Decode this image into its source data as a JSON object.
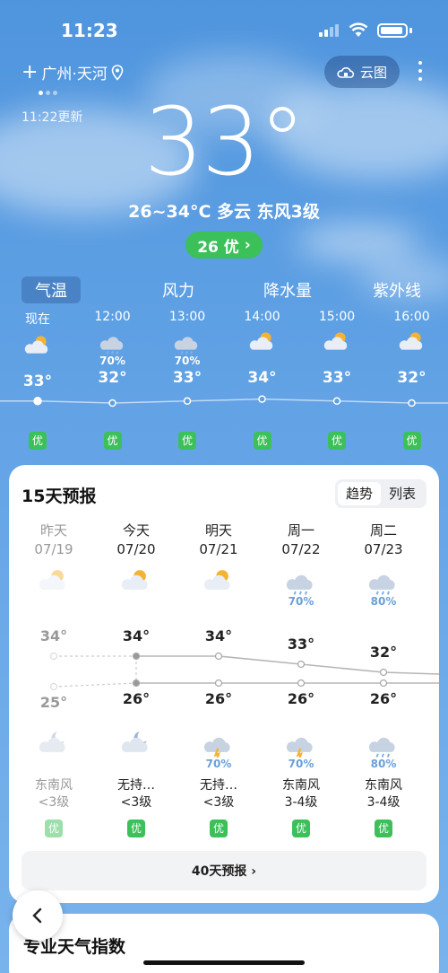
{
  "status": {
    "time": "11:23"
  },
  "location": {
    "city": "广州·天河",
    "updated": "11:22更新"
  },
  "header": {
    "cloud_map_label": "云图"
  },
  "current": {
    "temp": "33°",
    "summary": "26~34°C 多云 东风3级",
    "aqi": "26 优"
  },
  "tabs": [
    {
      "label": "气温"
    },
    {
      "label": "风力"
    },
    {
      "label": "降水量"
    },
    {
      "label": "紫外线"
    }
  ],
  "hourly": [
    {
      "time": "现在",
      "icon": "partly-cloudy-day-icon",
      "pop": "",
      "temp": "33°",
      "temp_value": 33,
      "aqi": "优"
    },
    {
      "time": "12:00",
      "icon": "rain-cloud-icon",
      "pop": "70%",
      "temp": "32°",
      "temp_value": 32,
      "aqi": "优"
    },
    {
      "time": "13:00",
      "icon": "rain-cloud-icon",
      "pop": "70%",
      "temp": "33°",
      "temp_value": 33,
      "aqi": "优"
    },
    {
      "time": "14:00",
      "icon": "partly-cloudy-day-icon",
      "pop": "",
      "temp": "34°",
      "temp_value": 34,
      "aqi": "优"
    },
    {
      "time": "15:00",
      "icon": "partly-cloudy-day-icon",
      "pop": "",
      "temp": "33°",
      "temp_value": 33,
      "aqi": "优"
    },
    {
      "time": "16:00",
      "icon": "partly-cloudy-day-icon",
      "pop": "",
      "temp": "32°",
      "temp_value": 32,
      "aqi": "优"
    }
  ],
  "forecast": {
    "title": "15天预报",
    "toggle": {
      "trend": "趋势",
      "list": "列表"
    },
    "days": [
      {
        "name": "昨天",
        "date": "07/19",
        "icon_day": "partly-cloudy-day-icon",
        "pop_day": "",
        "hi": "34°",
        "hi_value": 34,
        "lo": "25°",
        "lo_value": 25,
        "icon_night": "cloudy-night-icon",
        "pop_night": "",
        "wind1": "东南风",
        "wind2": "<3级",
        "aqi": "优"
      },
      {
        "name": "今天",
        "date": "07/20",
        "icon_day": "partly-cloudy-day-icon",
        "pop_day": "",
        "hi": "34°",
        "hi_value": 34,
        "lo": "26°",
        "lo_value": 26,
        "icon_night": "partly-cloudy-night-icon",
        "pop_night": "",
        "wind1": "无持…",
        "wind2": "<3级",
        "aqi": "优"
      },
      {
        "name": "明天",
        "date": "07/21",
        "icon_day": "partly-cloudy-day-icon",
        "pop_day": "",
        "hi": "34°",
        "hi_value": 34,
        "lo": "26°",
        "lo_value": 26,
        "icon_night": "thunderstorm-icon",
        "pop_night": "70%",
        "wind1": "无持…",
        "wind2": "<3级",
        "aqi": "优"
      },
      {
        "name": "周一",
        "date": "07/22",
        "icon_day": "rain-cloud-icon",
        "pop_day": "70%",
        "hi": "33°",
        "hi_value": 33,
        "lo": "26°",
        "lo_value": 26,
        "icon_night": "thunderstorm-icon",
        "pop_night": "70%",
        "wind1": "东南风",
        "wind2": "3-4级",
        "aqi": "优"
      },
      {
        "name": "周二",
        "date": "07/23",
        "icon_day": "rain-cloud-icon",
        "pop_day": "80%",
        "hi": "32°",
        "hi_value": 32,
        "lo": "26°",
        "lo_value": 26,
        "icon_night": "rain-cloud-icon",
        "pop_night": "80%",
        "wind1": "东南风",
        "wind2": "3-4级",
        "aqi": "优"
      }
    ],
    "forty_day_label": "40天预报 ›"
  },
  "indices": {
    "title": "专业天气指数"
  },
  "colors": {
    "aqi_good": "#3cc05a",
    "pop_blue": "#6a9fd8",
    "sun": "#f5b333"
  }
}
